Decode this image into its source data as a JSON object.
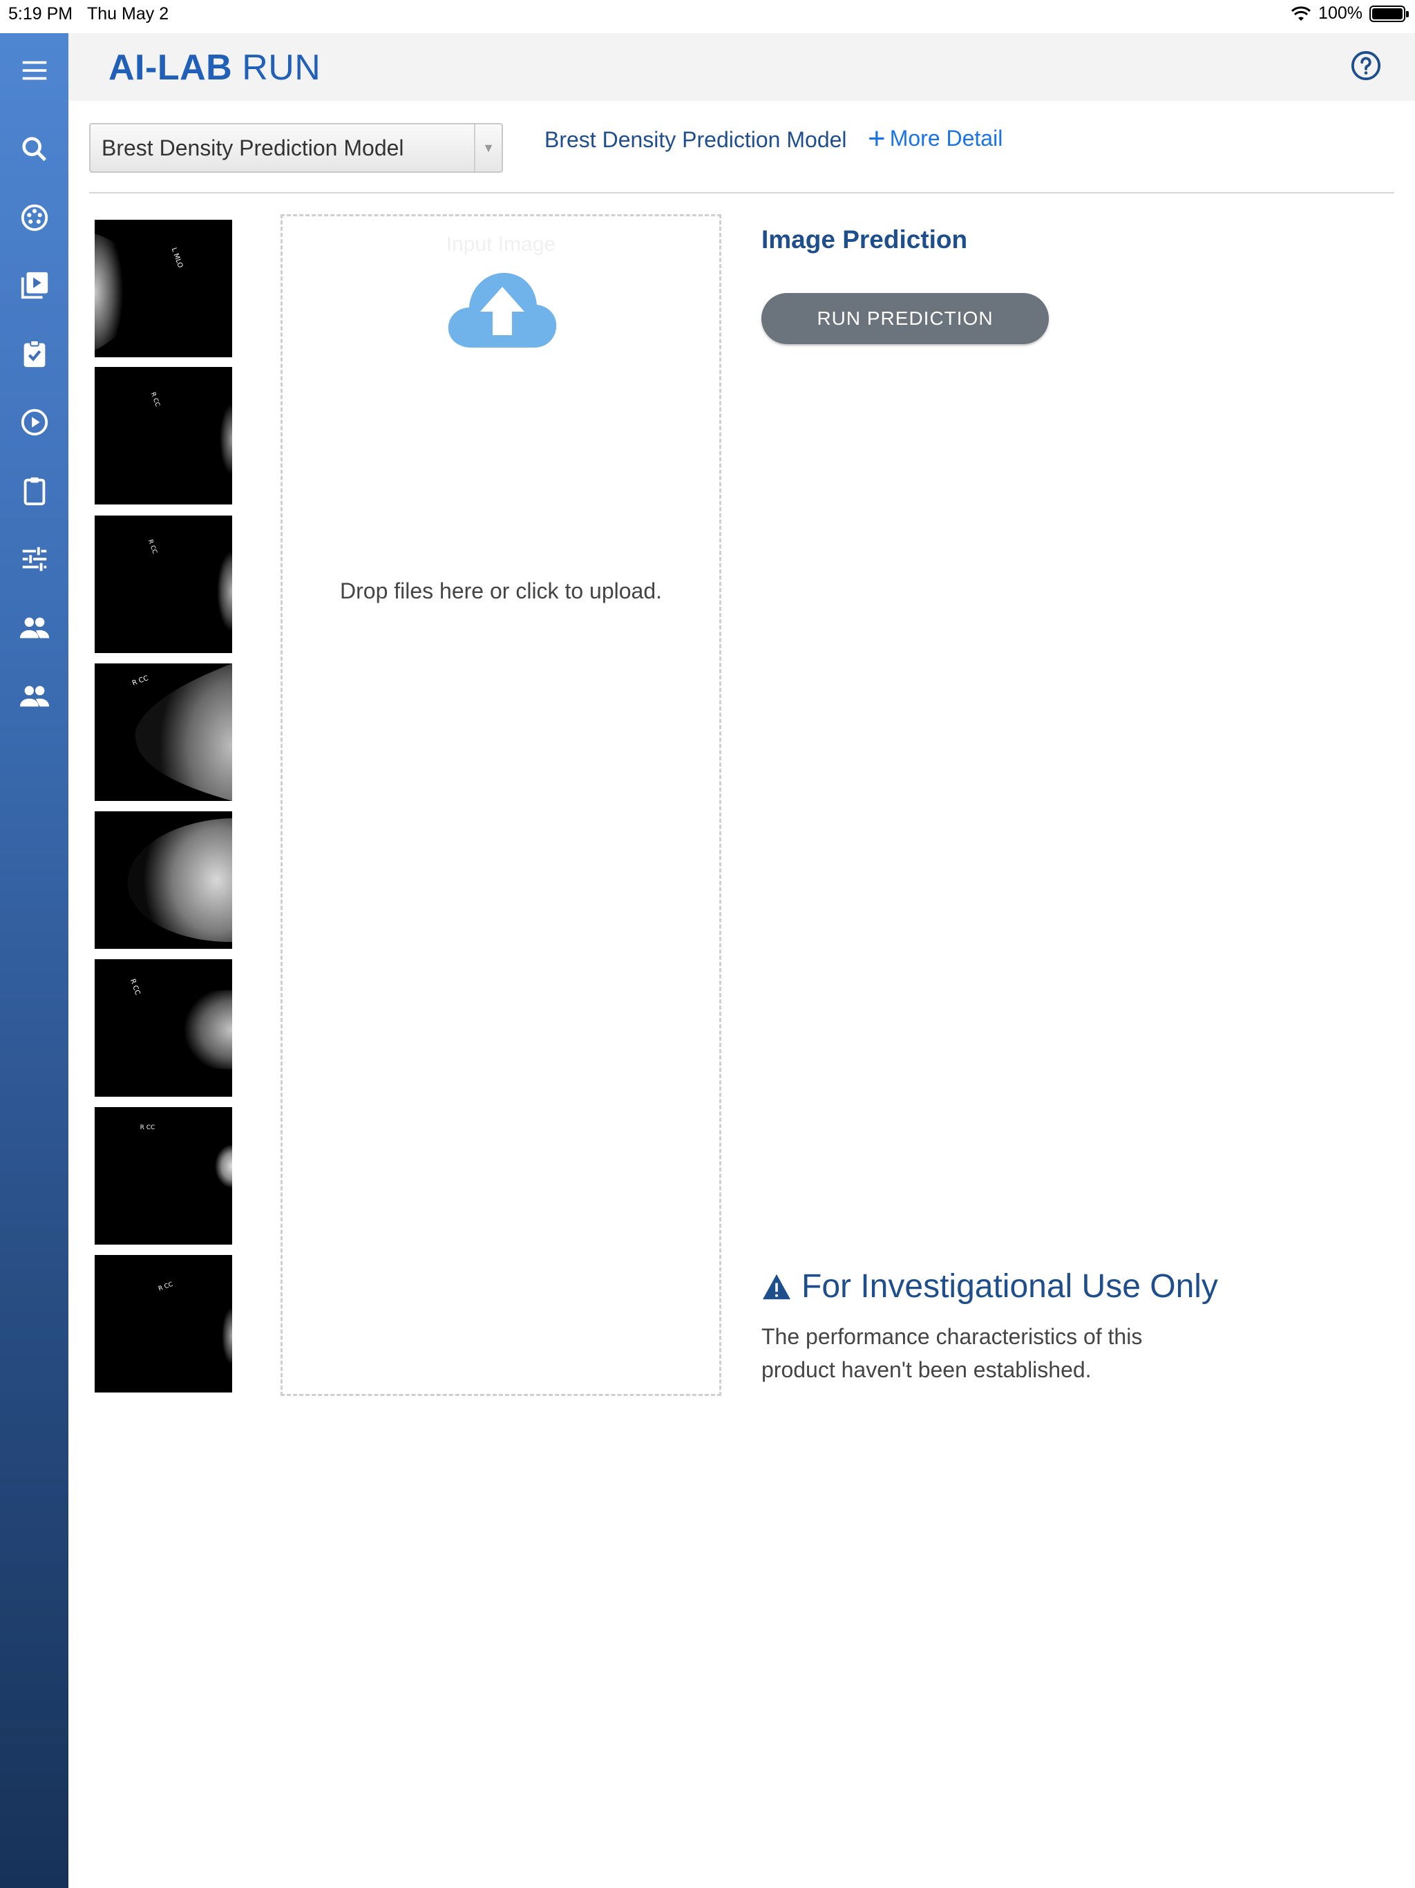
{
  "status_bar": {
    "time": "5:19 PM",
    "date": "Thu May 2",
    "battery": "100%"
  },
  "header": {
    "brand_primary": "AI-LAB",
    "brand_secondary": "RUN"
  },
  "sidebar": {
    "items": [
      {
        "icon": "menu-icon"
      },
      {
        "icon": "search-icon"
      },
      {
        "icon": "palette-icon"
      },
      {
        "icon": "video-library-icon"
      },
      {
        "icon": "assignment-check-icon"
      },
      {
        "icon": "play-circle-icon"
      },
      {
        "icon": "clipboard-icon"
      },
      {
        "icon": "tune-icon"
      },
      {
        "icon": "people-icon"
      },
      {
        "icon": "people-icon"
      }
    ]
  },
  "model": {
    "selected": "Brest Density Prediction Model",
    "name_link": "Brest Density Prediction Model",
    "more_detail": "More Detail"
  },
  "thumbnails": [
    {
      "label": "L MLO"
    },
    {
      "label": "R CC"
    },
    {
      "label": "R CC"
    },
    {
      "label": "R CC"
    },
    {
      "label": ""
    },
    {
      "label": "R CC"
    },
    {
      "label": "R CC"
    },
    {
      "label": "R CC"
    }
  ],
  "upload": {
    "section_label": "Input Image",
    "message": "Drop files here or click to upload."
  },
  "prediction": {
    "title": "Image Prediction",
    "run_button": "RUN PREDICTION"
  },
  "disclaimer": {
    "title": "For Investigational Use Only",
    "text": "The performance characteristics of this product haven't been established."
  },
  "colors": {
    "brand": "#2060b8",
    "accent_link": "#1a73e8",
    "heading": "#1f4e8c",
    "button_gray": "#6b737d",
    "cloud": "#6fb3ea"
  }
}
